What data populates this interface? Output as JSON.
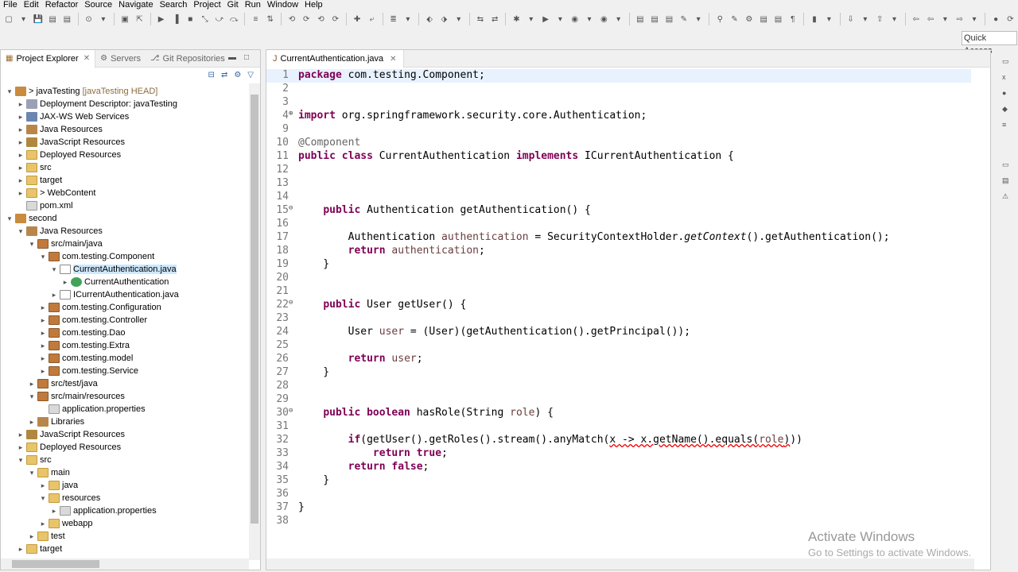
{
  "menu": [
    "File",
    "Edit",
    "Refactor",
    "Source",
    "Navigate",
    "Search",
    "Project",
    "Git",
    "Run",
    "Window",
    "Help"
  ],
  "quick_access": "Quick Access",
  "left_tabs": [
    {
      "label": "Project Explorer",
      "close": "✕"
    },
    {
      "label": "Servers"
    },
    {
      "label": "Git Repositories"
    }
  ],
  "tree": [
    {
      "label": "> javaTesting",
      "dec": " [javaTesting HEAD]",
      "depth": 0,
      "arrow": "▾",
      "icon": "proj"
    },
    {
      "label": "Deployment Descriptor: javaTesting",
      "depth": 1,
      "arrow": "▸",
      "icon": "desc"
    },
    {
      "label": "JAX-WS Web Services",
      "depth": 1,
      "arrow": "▸",
      "icon": "ws"
    },
    {
      "label": "Java Resources",
      "depth": 1,
      "arrow": "▸",
      "icon": "lib"
    },
    {
      "label": "JavaScript Resources",
      "depth": 1,
      "arrow": "▸",
      "icon": "js"
    },
    {
      "label": "Deployed Resources",
      "depth": 1,
      "arrow": "▸",
      "icon": "folder"
    },
    {
      "label": "src",
      "depth": 1,
      "arrow": "▸",
      "icon": "folder"
    },
    {
      "label": "target",
      "depth": 1,
      "arrow": "▸",
      "icon": "folder"
    },
    {
      "label": "> WebContent",
      "depth": 1,
      "arrow": "▸",
      "icon": "folder"
    },
    {
      "label": "pom.xml",
      "depth": 1,
      "arrow": "",
      "icon": "xml"
    },
    {
      "label": "second",
      "depth": 0,
      "arrow": "▾",
      "icon": "proj"
    },
    {
      "label": "Java Resources",
      "depth": 1,
      "arrow": "▾",
      "icon": "lib"
    },
    {
      "label": "src/main/java",
      "depth": 2,
      "arrow": "▾",
      "icon": "pkg"
    },
    {
      "label": "com.testing.Component",
      "depth": 3,
      "arrow": "▾",
      "icon": "pkg"
    },
    {
      "label": "CurrentAuthentication.java",
      "depth": 4,
      "arrow": "▾",
      "icon": "java",
      "selected": true
    },
    {
      "label": "CurrentAuthentication",
      "depth": 5,
      "arrow": "▸",
      "icon": "cls"
    },
    {
      "label": "ICurrentAuthentication.java",
      "depth": 4,
      "arrow": "▸",
      "icon": "java"
    },
    {
      "label": "com.testing.Configuration",
      "depth": 3,
      "arrow": "▸",
      "icon": "pkg"
    },
    {
      "label": "com.testing.Controller",
      "depth": 3,
      "arrow": "▸",
      "icon": "pkg"
    },
    {
      "label": "com.testing.Dao",
      "depth": 3,
      "arrow": "▸",
      "icon": "pkg"
    },
    {
      "label": "com.testing.Extra",
      "depth": 3,
      "arrow": "▸",
      "icon": "pkg"
    },
    {
      "label": "com.testing.model",
      "depth": 3,
      "arrow": "▸",
      "icon": "pkg"
    },
    {
      "label": "com.testing.Service",
      "depth": 3,
      "arrow": "▸",
      "icon": "pkg"
    },
    {
      "label": "src/test/java",
      "depth": 2,
      "arrow": "▸",
      "icon": "pkg"
    },
    {
      "label": "src/main/resources",
      "depth": 2,
      "arrow": "▾",
      "icon": "pkg"
    },
    {
      "label": "application.properties",
      "depth": 3,
      "arrow": "",
      "icon": "xml"
    },
    {
      "label": "Libraries",
      "depth": 2,
      "arrow": "▸",
      "icon": "lib"
    },
    {
      "label": "JavaScript Resources",
      "depth": 1,
      "arrow": "▸",
      "icon": "js"
    },
    {
      "label": "Deployed Resources",
      "depth": 1,
      "arrow": "▸",
      "icon": "folder"
    },
    {
      "label": "src",
      "depth": 1,
      "arrow": "▾",
      "icon": "folder"
    },
    {
      "label": "main",
      "depth": 2,
      "arrow": "▾",
      "icon": "folder"
    },
    {
      "label": "java",
      "depth": 3,
      "arrow": "▸",
      "icon": "folder"
    },
    {
      "label": "resources",
      "depth": 3,
      "arrow": "▾",
      "icon": "folder"
    },
    {
      "label": "application.properties",
      "depth": 4,
      "arrow": "▸",
      "icon": "xml"
    },
    {
      "label": "webapp",
      "depth": 3,
      "arrow": "▸",
      "icon": "folder"
    },
    {
      "label": "test",
      "depth": 2,
      "arrow": "▸",
      "icon": "folder"
    },
    {
      "label": "target",
      "depth": 1,
      "arrow": "▸",
      "icon": "folder"
    }
  ],
  "editor_tab": "CurrentAuthentication.java",
  "code_lines": [
    {
      "n": "1",
      "html": "<span class=\"kw\">package</span> com.testing.Component;",
      "cur": true
    },
    {
      "n": "2",
      "html": ""
    },
    {
      "n": "3",
      "html": ""
    },
    {
      "n": "4",
      "fold": "⊕",
      "html": "<span class=\"kw\">import</span> org.springframework.security.core.Authentication;"
    },
    {
      "n": "9",
      "html": ""
    },
    {
      "n": "10",
      "html": "<span class=\"ann\">@Component</span>"
    },
    {
      "n": "11",
      "html": "<span class=\"kw\">public class</span> CurrentAuthentication <span class=\"kw\">implements</span> ICurrentAuthentication {"
    },
    {
      "n": "12",
      "html": ""
    },
    {
      "n": "13",
      "html": ""
    },
    {
      "n": "14",
      "html": ""
    },
    {
      "n": "15",
      "fold": "⊖",
      "html": "    <span class=\"kw\">public</span> Authentication getAuthentication() {"
    },
    {
      "n": "16",
      "html": ""
    },
    {
      "n": "17",
      "html": "        Authentication <span class=\"var\">authentication</span> = SecurityContextHolder.<span class=\"it\">getContext</span>().getAuthentication();"
    },
    {
      "n": "18",
      "html": "        <span class=\"kw\">return</span> <span class=\"var\">authentication</span>;"
    },
    {
      "n": "19",
      "html": "    }"
    },
    {
      "n": "20",
      "html": ""
    },
    {
      "n": "21",
      "html": ""
    },
    {
      "n": "22",
      "fold": "⊖",
      "html": "    <span class=\"kw\">public</span> User getUser() {"
    },
    {
      "n": "23",
      "html": ""
    },
    {
      "n": "24",
      "html": "        User <span class=\"var\">user</span> = (User)(getAuthentication().getPrincipal());"
    },
    {
      "n": "25",
      "html": ""
    },
    {
      "n": "26",
      "html": "        <span class=\"kw\">return</span> <span class=\"var\">user</span>;"
    },
    {
      "n": "27",
      "html": "    }"
    },
    {
      "n": "28",
      "html": ""
    },
    {
      "n": "29",
      "html": ""
    },
    {
      "n": "30",
      "fold": "⊖",
      "html": "    <span class=\"kw\">public boolean</span> hasRole(String <span class=\"var\">role</span>) {"
    },
    {
      "n": "31",
      "html": ""
    },
    {
      "n": "32",
      "html": "        <span class=\"kw\">if</span>(getUser().getRoles().stream().anyMatch(<span class=\"err\">x -&gt; x.getName().equals(<span class=\"var\">role</span>)</span>))"
    },
    {
      "n": "33",
      "html": "            <span class=\"kw\">return true</span>;"
    },
    {
      "n": "34",
      "html": "        <span class=\"kw\">return false</span>;"
    },
    {
      "n": "35",
      "html": "    }"
    },
    {
      "n": "36",
      "html": ""
    },
    {
      "n": "37",
      "html": "}"
    },
    {
      "n": "38",
      "html": ""
    }
  ],
  "watermark": {
    "title": "Activate Windows",
    "sub": "Go to Settings to activate Windows."
  }
}
